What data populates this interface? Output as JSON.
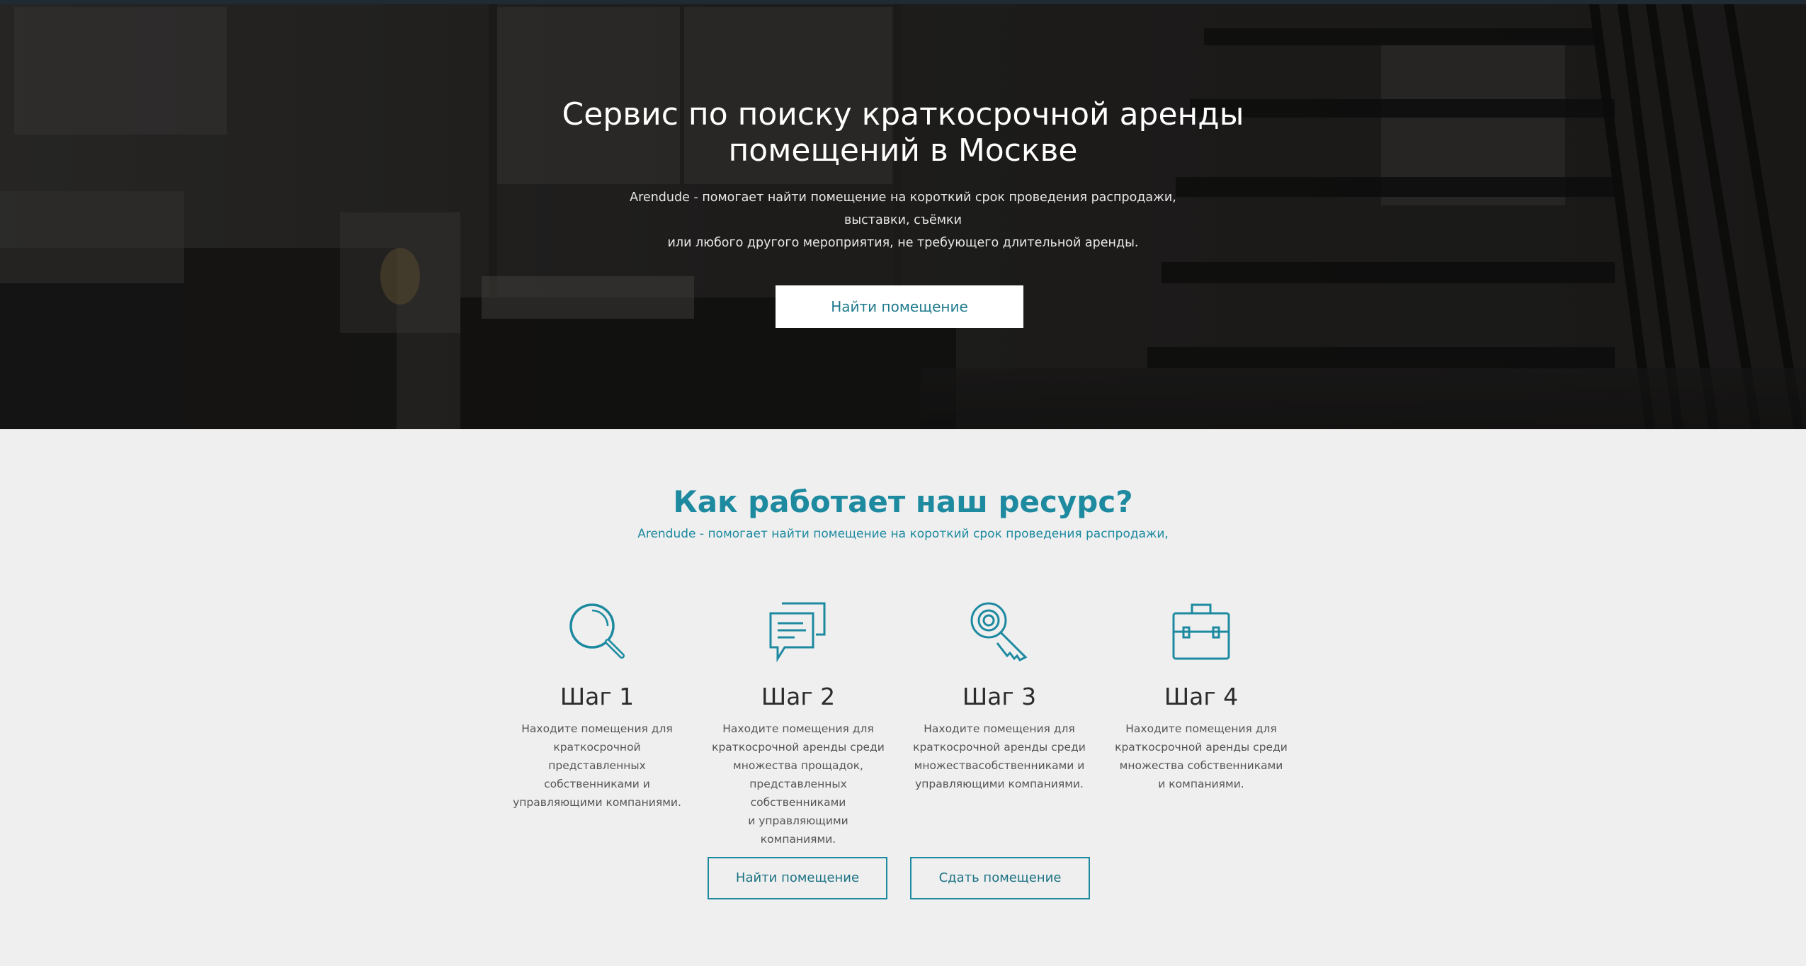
{
  "hero": {
    "title_line1": "Сервис по поиску краткосрочной аренды",
    "title_line2": "помещений в Москве",
    "subtitle_line1": "Arendude - помогает найти помещение на короткий срок проведения распродажи, выставки, съёмки",
    "subtitle_line2": "или любого другого мероприятия, не требующего длительной аренды.",
    "button_label": "Найти помещение"
  },
  "how": {
    "title": "Как работает наш ресурс?",
    "subtitle": "Arendude - помогает найти помещение на короткий срок проведения распродажи,",
    "steps": [
      {
        "icon": "search-icon",
        "title": "Шаг 1",
        "text_lines": [
          "Находите помещения для",
          "краткосрочной представленных",
          "собственниками и",
          "управляющими компаниями."
        ]
      },
      {
        "icon": "chat-icon",
        "title": "Шаг 2",
        "text_lines": [
          "Находите помещения для",
          "краткосрочной аренды среди",
          "множества прощадок,",
          "представленных собственниками",
          "и  управляющими компаниями."
        ]
      },
      {
        "icon": "key-icon",
        "title": "Шаг 3",
        "text_lines": [
          "Находите помещения для",
          "краткосрочной аренды среди",
          "множествасобственниками и",
          "управляющими компаниями."
        ]
      },
      {
        "icon": "briefcase-icon",
        "title": "Шаг 4",
        "text_lines": [
          "Находите помещения для",
          "краткосрочной аренды среди",
          "множества собственниками",
          "и компаниями."
        ]
      }
    ],
    "find_button": "Найти помещение",
    "rent_button": "Сдать помещение"
  },
  "colors": {
    "accent": "#1d8aa0",
    "hero_overlay": "#2b2927",
    "section_bg": "#efefef"
  }
}
